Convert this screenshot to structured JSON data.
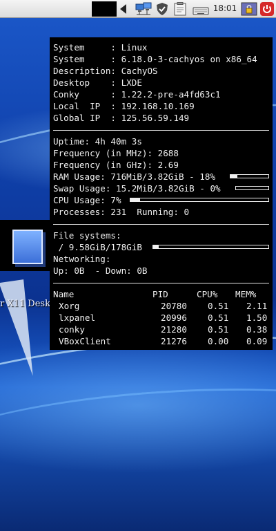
{
  "taskbar": {
    "clock": "18:01",
    "icons": [
      "arrow-left-icon",
      "network-icon",
      "shield-icon",
      "clipboard-icon",
      "keyboard-icon",
      "lock-icon",
      "power-icon"
    ]
  },
  "desktop": {
    "icon_label": "r X11 Desk"
  },
  "conky": {
    "system_lines": [
      "System     : Linux",
      "System     : 6.18.0-3-cachyos on x86_64",
      "Description: CachyOS",
      "Desktop    : LXDE",
      "Conky      : 1.22.2-pre-a4fd63c1",
      "Local  IP  : 192.168.10.169",
      "Global IP  : 125.56.59.149"
    ],
    "uptime": "Uptime: 4h 40m 3s",
    "freq_mhz": "Frequency (in MHz): 2688",
    "freq_ghz": "Frequency (in GHz): 2.69",
    "ram": {
      "text": "RAM Usage: 716MiB/3.82GiB - 18%",
      "percent": 18
    },
    "swap": {
      "text": "Swap Usage: 15.2MiB/3.82GiB - 0%",
      "percent": 0
    },
    "cpu": {
      "text": "CPU Usage: 7%",
      "percent": 7
    },
    "processes": "Processes: 231  Running: 0",
    "fs_heading": "File systems:",
    "fs_root": {
      "text": " / 9.58GiB/178GiB",
      "percent": 5
    },
    "net_heading": "Networking:",
    "net_line": "Up: 0B  - Down: 0B",
    "process_table": {
      "headers": [
        "Name",
        "PID",
        "CPU%",
        "MEM%"
      ],
      "rows": [
        [
          "Xorg",
          "20780",
          "0.51",
          "2.11"
        ],
        [
          "lxpanel",
          "20996",
          "0.51",
          "1.50"
        ],
        [
          "conky",
          "21280",
          "0.51",
          "0.38"
        ],
        [
          "VBoxClient",
          "21276",
          "0.00",
          "0.09"
        ]
      ]
    }
  }
}
